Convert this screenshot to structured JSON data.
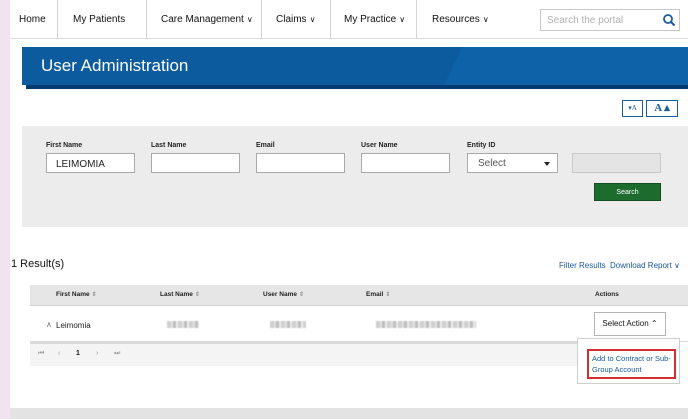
{
  "nav": {
    "home": "Home",
    "my_patients": "My Patients",
    "care_management": "Care Management",
    "claims": "Claims",
    "my_practice": "My Practice",
    "resources": "Resources",
    "search_placeholder": "Search the portal"
  },
  "banner": {
    "title": "User Administration"
  },
  "font_controls": {
    "decrease": "▾A",
    "increase": "A ▴"
  },
  "form": {
    "first_name_label": "First Name",
    "first_name_value": "LEIMOMIA",
    "last_name_label": "Last Name",
    "email_label": "Email",
    "user_name_label": "User Name",
    "entity_id_label": "Entity ID",
    "entity_id_value": "Select",
    "search_button": "Search"
  },
  "results": {
    "count_label": "1 Result(s)",
    "filter_link": "Filter Results",
    "download_link": "Download Report",
    "columns": [
      "First Name",
      "Last Name",
      "User Name",
      "Email",
      "Actions"
    ],
    "rows": [
      {
        "first_name": "Leimomia",
        "action_label": "Select Action"
      }
    ],
    "pager": {
      "first": "⏮",
      "prev": "‹",
      "page": "1",
      "next": "›",
      "last": "⏭"
    },
    "dropdown_item": "Add to Contract or Sub-Group Account"
  },
  "colors": {
    "banner": "#0e63a8",
    "search_button": "#1e6b2e",
    "link": "#1a5aa0",
    "highlight": "#d32f2f"
  }
}
